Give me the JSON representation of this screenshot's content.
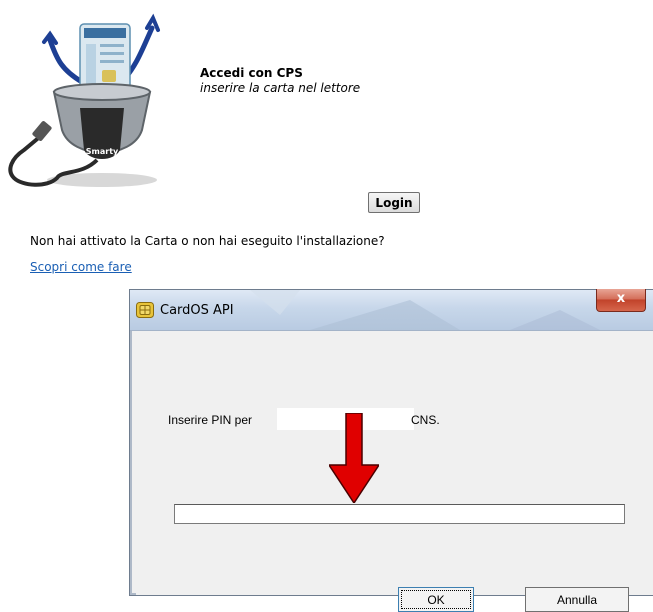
{
  "header": {
    "title": "Accedi con CPS",
    "subtitle": "inserire la carta nel lettore",
    "reader_brand": "Smarty"
  },
  "login": {
    "label": "Login"
  },
  "activation": {
    "question": "Non hai attivato la Carta o non hai eseguito l'installazione?",
    "link": "Scopri come fare"
  },
  "dialog": {
    "title": "CardOS API",
    "close_label": "x",
    "prompt_prefix": "Inserire PIN per",
    "prompt_suffix": "CNS.",
    "pin_value": "",
    "ok_label": "OK",
    "cancel_label": "Annulla"
  },
  "colors": {
    "link": "#1a5fb4",
    "arrow": "#e00000",
    "close_button": "#c1432b"
  }
}
